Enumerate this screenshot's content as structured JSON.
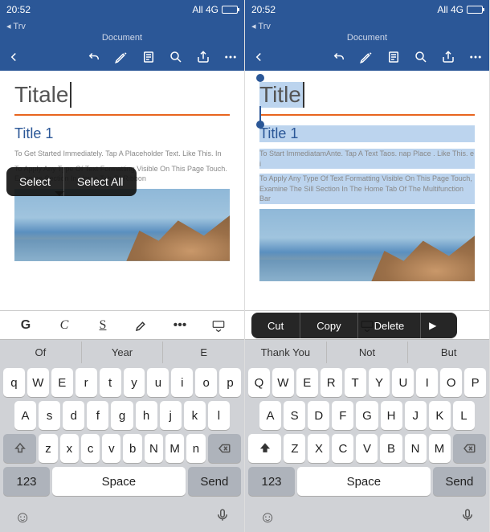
{
  "left": {
    "status": {
      "time": "20:52",
      "network": "All 4G",
      "tab": "◂ Trv"
    },
    "doc_label": "Document",
    "doc": {
      "title": "Titale",
      "heading": "Title 1",
      "body1": "To Get Started Immediately. Tap A Placeholder Text. Like This. In",
      "body2": "To Apply Any Type Of Text Formatting Visible On This Page Touch. Examine Section In Home Tab Of Ribbon"
    },
    "sel_menu": {
      "select": "Select",
      "select_all": "Select All"
    },
    "format": {
      "bold": "G",
      "italic": "C",
      "underline": "S"
    },
    "suggestions": [
      "Of",
      "Year",
      "E"
    ],
    "keys": {
      "row1": [
        "q",
        "W",
        "E",
        "r",
        "t",
        "y",
        "u",
        "i",
        "o",
        "p"
      ],
      "row2": [
        "A",
        "s",
        "d",
        "f",
        "g",
        "h",
        "j",
        "k",
        "l"
      ],
      "row3": [
        "z",
        "x",
        "c",
        "v",
        "b",
        "N",
        "M",
        "n"
      ],
      "num": "123",
      "space": "Space",
      "send": "Send"
    }
  },
  "right": {
    "status": {
      "time": "20:52",
      "network": "All 4G",
      "tab": "◂ Trv"
    },
    "doc_label": "Document",
    "doc": {
      "title": "Title",
      "heading": "Title 1",
      "body1": "To Start ImmediatamAnte. Tap A Text Taos. nap Place . Like This. e i",
      "body2": "To Apply Any Type Of Text Formatting Visible On This Page Touch, Examine The Sill Section In The Home Tab Of The Multifunction Bar"
    },
    "ctx_menu": {
      "cut": "Cut",
      "copy": "Copy",
      "delete": "Delete"
    },
    "suggestions": [
      "Thank You",
      "Not",
      "But"
    ],
    "keys": {
      "row1": [
        "Q",
        "W",
        "E",
        "R",
        "T",
        "Y",
        "U",
        "I",
        "O",
        "P"
      ],
      "row2": [
        "A",
        "S",
        "D",
        "F",
        "G",
        "H",
        "J",
        "K",
        "L"
      ],
      "row3": [
        "Z",
        "X",
        "C",
        "V",
        "B",
        "N",
        "M"
      ],
      "num": "123",
      "space": "Space",
      "send": "Send"
    }
  }
}
